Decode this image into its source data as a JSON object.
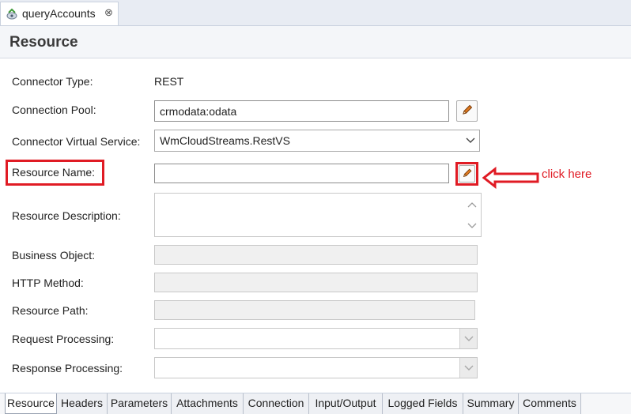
{
  "editor_tab": {
    "title": "queryAccounts",
    "close_glyph": "⊗"
  },
  "section": {
    "title": "Resource"
  },
  "form": {
    "connector_type": {
      "label": "Connector Type:",
      "value": "REST"
    },
    "connection_pool": {
      "label": "Connection Pool:",
      "value": "crmodata:odata",
      "edit_icon": "pencil-icon"
    },
    "connector_virtual_service": {
      "label": "Connector Virtual Service:",
      "value": "WmCloudStreams.RestVS"
    },
    "resource_name": {
      "label": "Resource Name:",
      "value": "",
      "edit_icon": "pencil-icon"
    },
    "resource_description": {
      "label": "Resource Description:",
      "value": ""
    },
    "business_object": {
      "label": "Business Object:",
      "value": ""
    },
    "http_method": {
      "label": "HTTP Method:",
      "value": ""
    },
    "resource_path": {
      "label": "Resource Path:",
      "value": ""
    },
    "request_processing": {
      "label": "Request Processing:",
      "value": ""
    },
    "response_processing": {
      "label": "Response Processing:",
      "value": ""
    }
  },
  "annotation": {
    "text": "click here",
    "color": "#e01b24"
  },
  "bottom_tabs": [
    "Resource",
    "Headers",
    "Parameters",
    "Attachments",
    "Connection",
    "Input/Output",
    "Logged Fields",
    "Summary",
    "Comments"
  ],
  "active_bottom_tab": "Resource",
  "colors": {
    "accent_red": "#e01b24",
    "pencil_orange": "#e07a1f"
  }
}
